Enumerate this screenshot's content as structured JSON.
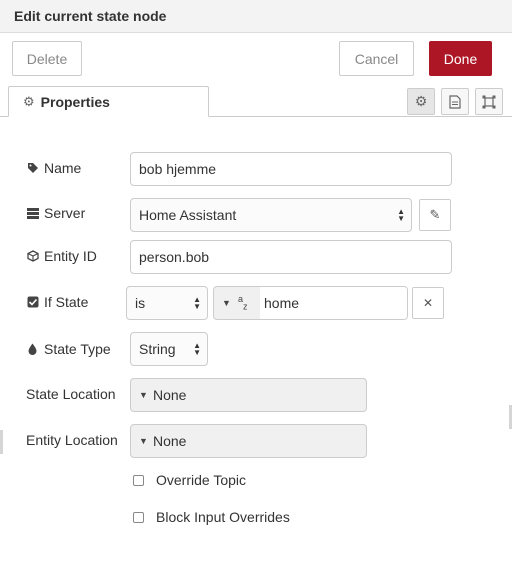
{
  "title": "Edit current state node",
  "toolbar": {
    "delete_label": "Delete",
    "cancel_label": "Cancel",
    "done_label": "Done"
  },
  "tab": {
    "label": "Properties",
    "icon": "gear-icon"
  },
  "tab_buttons": [
    "gear-icon",
    "document-icon",
    "frame-icon"
  ],
  "form": {
    "name": {
      "label": "Name",
      "icon": "tag-icon",
      "value": "bob hjemme"
    },
    "server": {
      "label": "Server",
      "icon": "server-icon",
      "value": "Home Assistant"
    },
    "entity_id": {
      "label": "Entity ID",
      "icon": "cube-icon",
      "value": "person.bob"
    },
    "if_state": {
      "label": "If State",
      "icon": "checked-box-icon",
      "operator": "is",
      "type_icon": "a-z",
      "value": "home"
    },
    "state_type": {
      "label": "State Type",
      "icon": "drop-icon",
      "value": "String"
    },
    "state_location": {
      "label": "State Location",
      "value": "None"
    },
    "entity_location": {
      "label": "Entity Location",
      "value": "None"
    },
    "override_topic": {
      "label": "Override Topic",
      "checked": false
    },
    "block_input_overrides": {
      "label": "Block Input Overrides",
      "checked": false
    }
  },
  "colors": {
    "primary": "#ad1625",
    "border": "#cccccc",
    "header_bg": "#f3f3f3"
  }
}
